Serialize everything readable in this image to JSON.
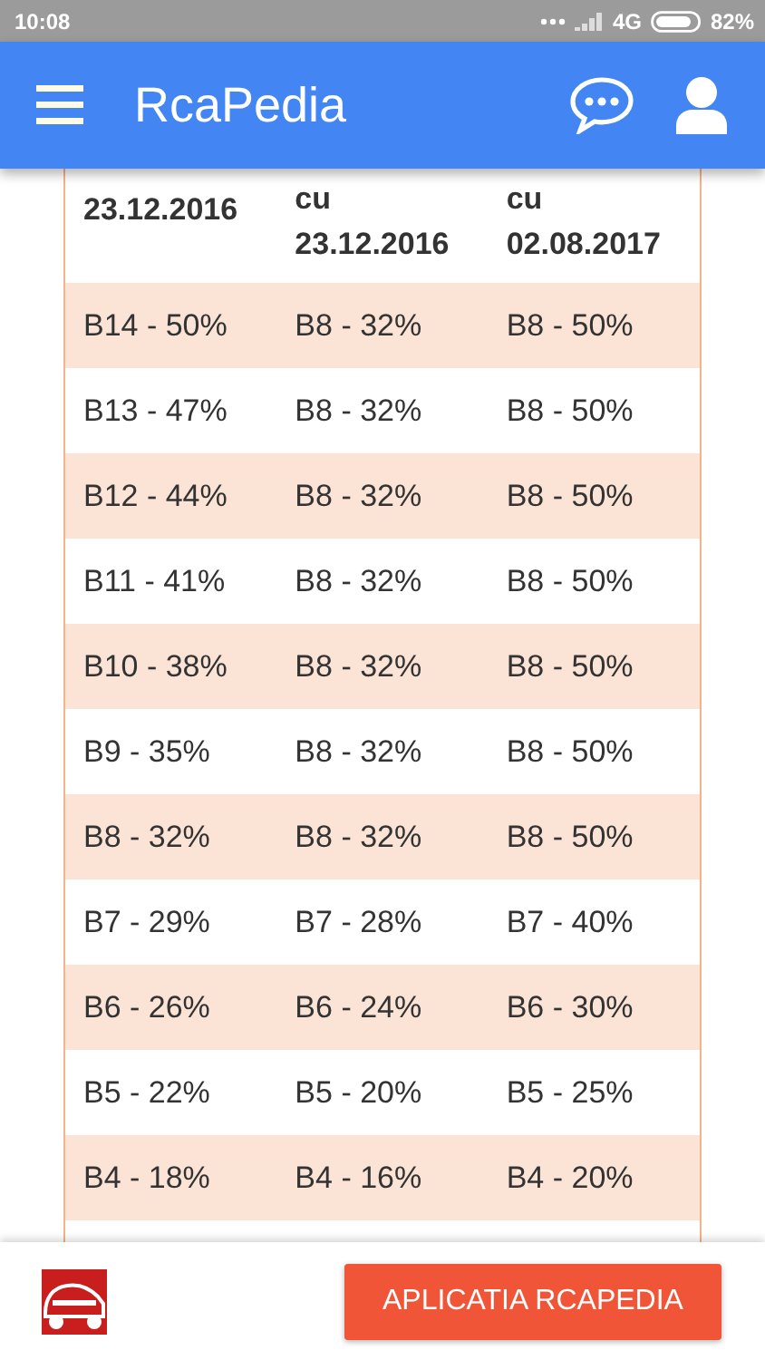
{
  "status_bar": {
    "time": "10:08",
    "network": "4G",
    "battery": "82%"
  },
  "app_bar": {
    "title": "RcaPedia"
  },
  "table": {
    "header": [
      {
        "lines": [
          "23.12.2016"
        ]
      },
      {
        "lines": [
          "cu",
          "23.12.2016"
        ]
      },
      {
        "lines": [
          "cu",
          "02.08.2017"
        ]
      }
    ],
    "rows": [
      [
        "B14 - 50%",
        "B8 - 32%",
        "B8 - 50%"
      ],
      [
        "B13 - 47%",
        "B8 - 32%",
        "B8 - 50%"
      ],
      [
        "B12 - 44%",
        "B8 - 32%",
        "B8 - 50%"
      ],
      [
        "B11 - 41%",
        "B8 - 32%",
        "B8 - 50%"
      ],
      [
        "B10 - 38%",
        "B8 - 32%",
        "B8 - 50%"
      ],
      [
        "B9 - 35%",
        "B8 - 32%",
        "B8 - 50%"
      ],
      [
        "B8 - 32%",
        "B8 - 32%",
        "B8 - 50%"
      ],
      [
        "B7 - 29%",
        "B7 - 28%",
        "B7 - 40%"
      ],
      [
        "B6 - 26%",
        "B6 - 24%",
        "B6 - 30%"
      ],
      [
        "B5 - 22%",
        "B5 - 20%",
        "B5 - 25%"
      ],
      [
        "B4 - 18%",
        "B4 - 16%",
        "B4 - 20%"
      ]
    ]
  },
  "bottom_bar": {
    "button": "APLICATIA RCAPEDIA"
  }
}
